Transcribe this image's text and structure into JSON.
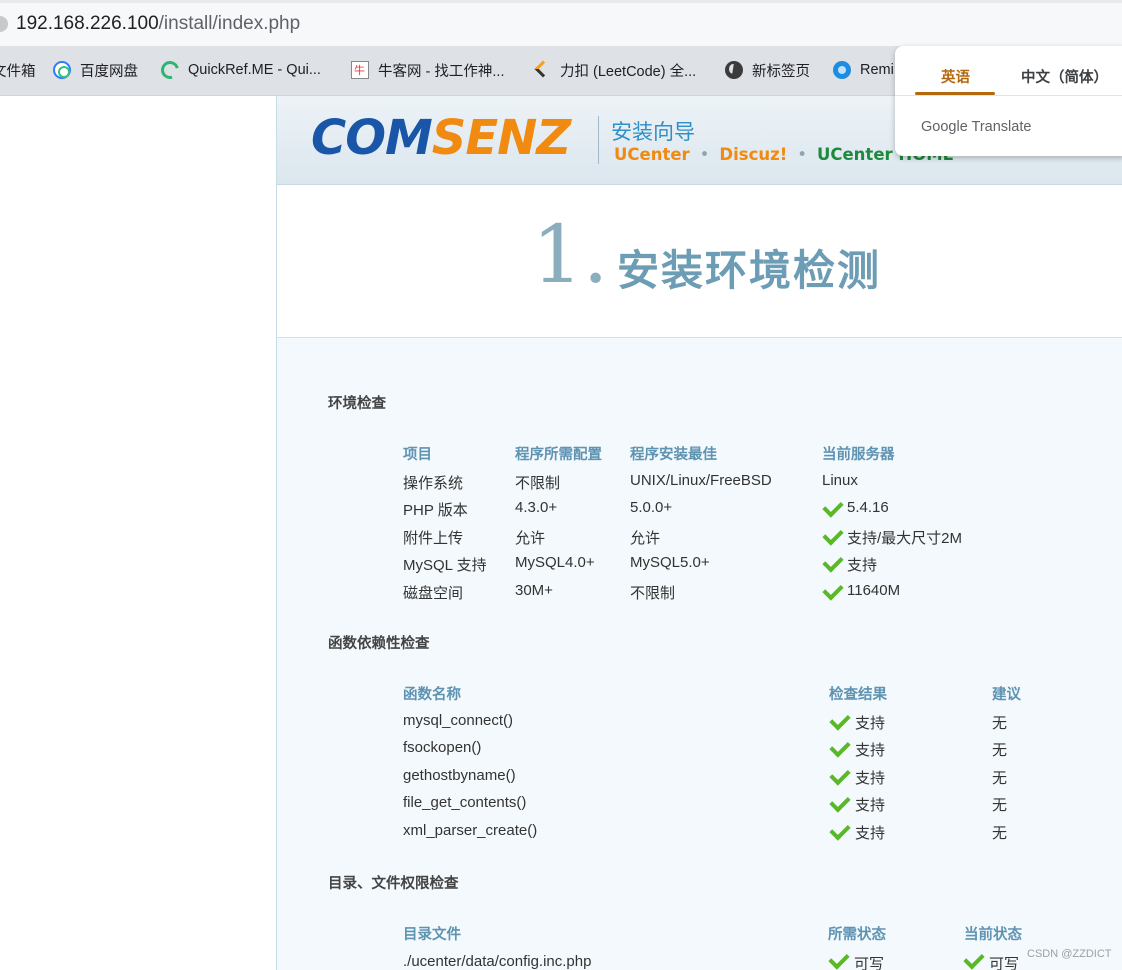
{
  "browser": {
    "url_host": "192.168.226.100",
    "url_path": "/install/index.php",
    "bookmarks": [
      {
        "label": "文件箱",
        "icon": "folder-icon"
      },
      {
        "label": "百度网盘",
        "icon": "baidu-netdisk-icon"
      },
      {
        "label": "QuickRef.ME - Qui...",
        "icon": "quickref-icon"
      },
      {
        "label": "牛客网 - 找工作神...",
        "icon": "nowcoder-icon"
      },
      {
        "label": "力扣 (LeetCode) 全...",
        "icon": "leetcode-icon"
      },
      {
        "label": "新标签页",
        "icon": "globe-icon"
      },
      {
        "label": "Remi",
        "icon": "remi-icon"
      }
    ]
  },
  "translate_popup": {
    "tab_source": "英语",
    "tab_target": "中文（简体）",
    "brand": "Google Translate"
  },
  "header": {
    "logo_part1": "COM",
    "logo_part2": "SENZ",
    "wizard_title": "安装向导",
    "product1": "UCenter",
    "product2": "Discuz!",
    "product3": "UCenter HOME",
    "separator": "•"
  },
  "step": {
    "number": "1.",
    "title": "安装环境检测"
  },
  "env_check": {
    "label": "环境检查",
    "headers": [
      "项目",
      "程序所需配置",
      "程序安装最佳",
      "当前服务器"
    ],
    "rows": [
      [
        "操作系统",
        "不限制",
        "UNIX/Linux/FreeBSD",
        "Linux"
      ],
      [
        "PHP 版本",
        "4.3.0+",
        "5.0.0+",
        "5.4.16"
      ],
      [
        "附件上传",
        "允许",
        "允许",
        "支持/最大尺寸2M"
      ],
      [
        "MySQL 支持",
        "MySQL4.0+",
        "MySQL5.0+",
        "支持"
      ],
      [
        "磁盘空间",
        "30M+",
        "不限制",
        "11640M"
      ]
    ]
  },
  "func_check": {
    "label": "函数依赖性检查",
    "headers": [
      "函数名称",
      "检查结果",
      "建议"
    ],
    "rows": [
      [
        "mysql_connect()",
        "支持",
        "无"
      ],
      [
        "fsockopen()",
        "支持",
        "无"
      ],
      [
        "gethostbyname()",
        "支持",
        "无"
      ],
      [
        "file_get_contents()",
        "支持",
        "无"
      ],
      [
        "xml_parser_create()",
        "支持",
        "无"
      ]
    ]
  },
  "dir_check": {
    "label": "目录、文件权限检查",
    "headers": [
      "目录文件",
      "所需状态",
      "当前状态"
    ],
    "rows": [
      [
        "./ucenter/data/config.inc.php",
        "可写",
        "可写"
      ]
    ]
  },
  "watermark": "CSDN @ZZDICT",
  "colors": {
    "accent_orange": "#f08a10",
    "logo_blue": "#1a56a8",
    "header_text": "#5e93b2",
    "check_green": "#5ab826"
  }
}
